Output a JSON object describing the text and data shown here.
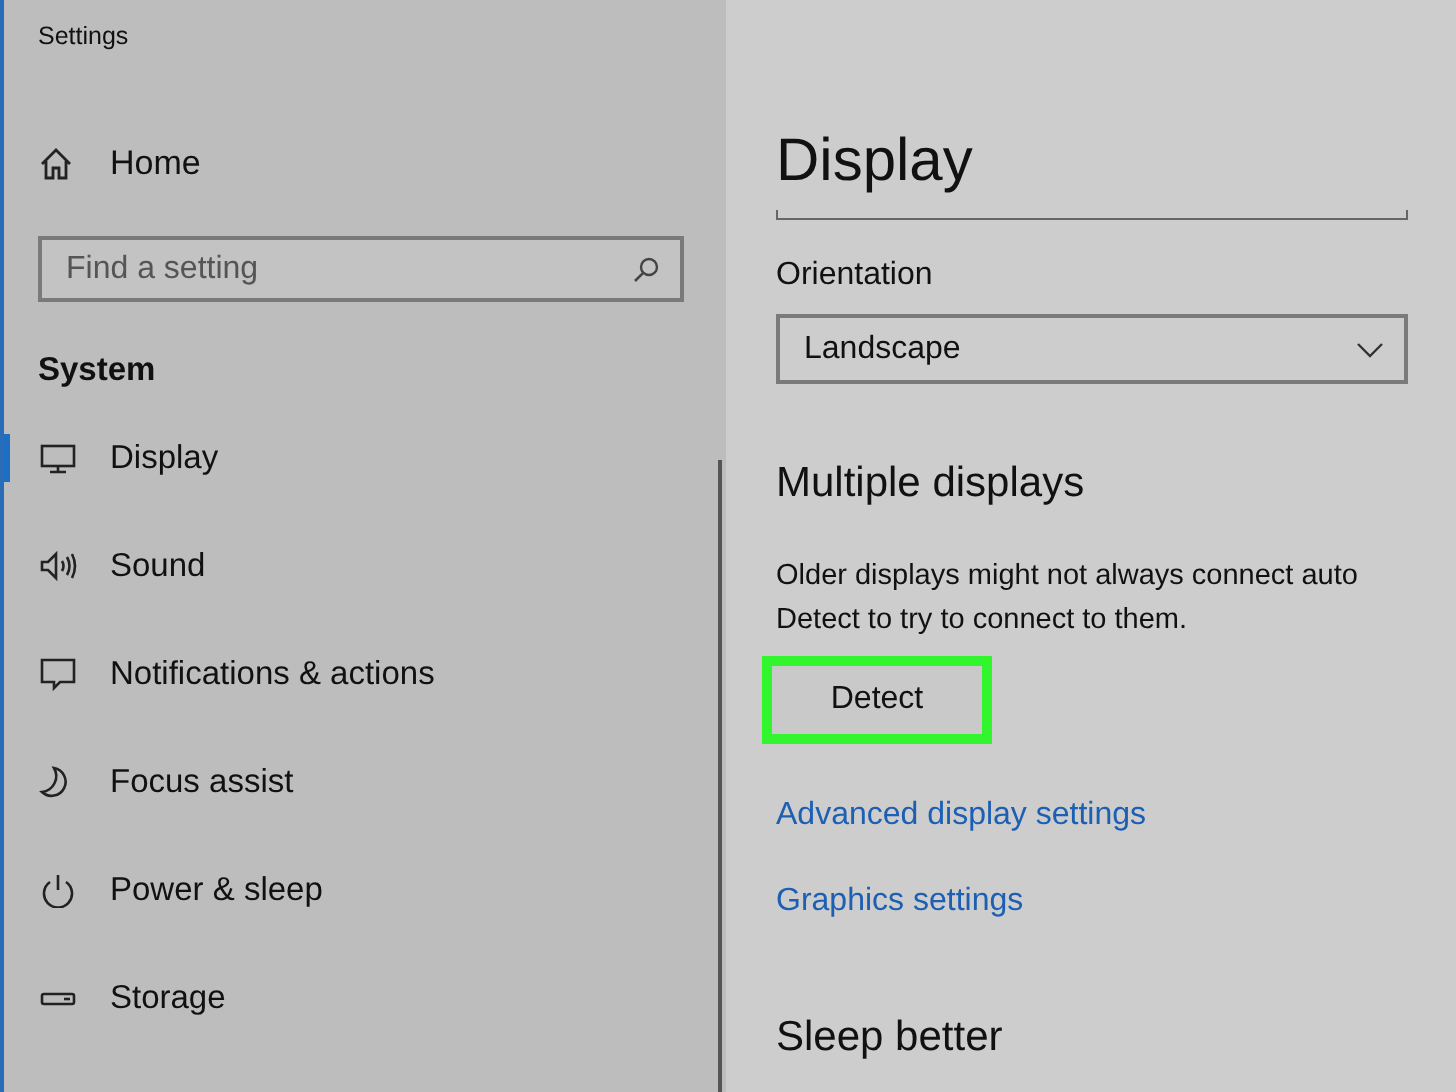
{
  "window": {
    "title": "Settings"
  },
  "sidebar": {
    "home": "Home",
    "search": {
      "placeholder": "Find a setting"
    },
    "section": "System",
    "items": [
      {
        "label": "Display",
        "selected": true
      },
      {
        "label": "Sound",
        "selected": false
      },
      {
        "label": "Notifications & actions",
        "selected": false
      },
      {
        "label": "Focus assist",
        "selected": false
      },
      {
        "label": "Power & sleep",
        "selected": false
      },
      {
        "label": "Storage",
        "selected": false
      }
    ]
  },
  "content": {
    "title": "Display",
    "orientation": {
      "label": "Orientation",
      "value": "Landscape"
    },
    "multiple_displays": {
      "heading": "Multiple displays",
      "description": [
        "Older displays might not always connect auto",
        "Detect to try to connect to them."
      ],
      "detect_button": {
        "label": "Detect",
        "highlighted": true
      }
    },
    "links": [
      "Advanced display settings",
      "Graphics settings"
    ],
    "next_heading": "Sleep better"
  }
}
